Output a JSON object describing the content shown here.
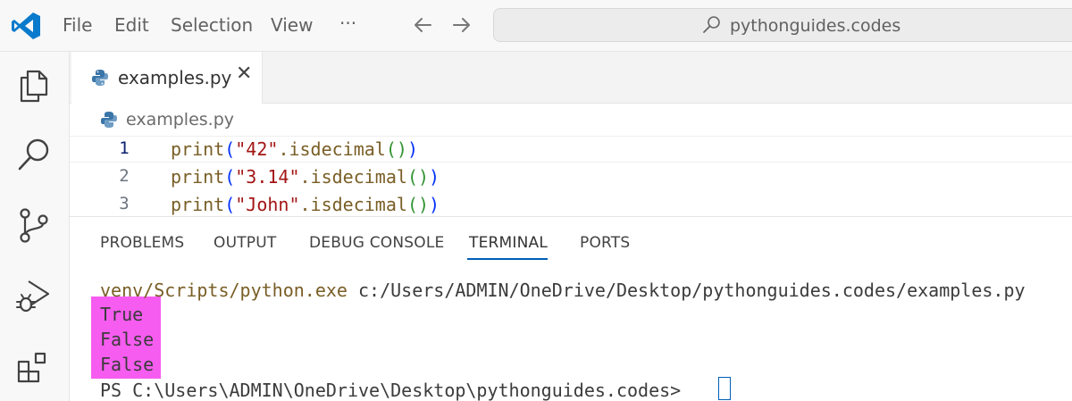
{
  "menu": {
    "file": "File",
    "edit": "Edit",
    "selection": "Selection",
    "view": "View",
    "more": "···"
  },
  "search": {
    "text": "pythonguides.codes"
  },
  "icons": {
    "logo": "vscode-logo-icon",
    "explorer": "files-icon",
    "search": "search-icon",
    "scm": "source-control-icon",
    "debug": "run-debug-icon",
    "extensions": "extensions-icon"
  },
  "colors": {
    "accent": "#005fb8",
    "highlight": "#f65cf0",
    "string": "#a31515",
    "function": "#795e26"
  },
  "tab": {
    "label": "examples.py",
    "close": "✕"
  },
  "breadcrumb": {
    "label": "examples.py"
  },
  "editor": {
    "lines": [
      {
        "num": "1",
        "fn": "print",
        "open": "(",
        "str": "\"42\"",
        "method": ".isdecimal",
        "call": "()",
        "close": ")"
      },
      {
        "num": "2",
        "fn": "print",
        "open": "(",
        "str": "\"3.14\"",
        "method": ".isdecimal",
        "call": "()",
        "close": ")"
      },
      {
        "num": "3",
        "fn": "print",
        "open": "(",
        "str": "\"John\"",
        "method": ".isdecimal",
        "call": "()",
        "close": ")"
      }
    ]
  },
  "panel": {
    "tabs": [
      "PROBLEMS",
      "OUTPUT",
      "DEBUG CONSOLE",
      "TERMINAL",
      "PORTS"
    ],
    "active_tab": "TERMINAL"
  },
  "terminal": {
    "command_prefix": "venv/Scripts/python.exe",
    "command_path": " c:/Users/ADMIN/OneDrive/Desktop/pythonguides.codes/examples.py",
    "outputs": [
      "True",
      "False",
      "False"
    ],
    "prompt": "PS C:\\Users\\ADMIN\\OneDrive\\Desktop\\pythonguides.codes>"
  }
}
